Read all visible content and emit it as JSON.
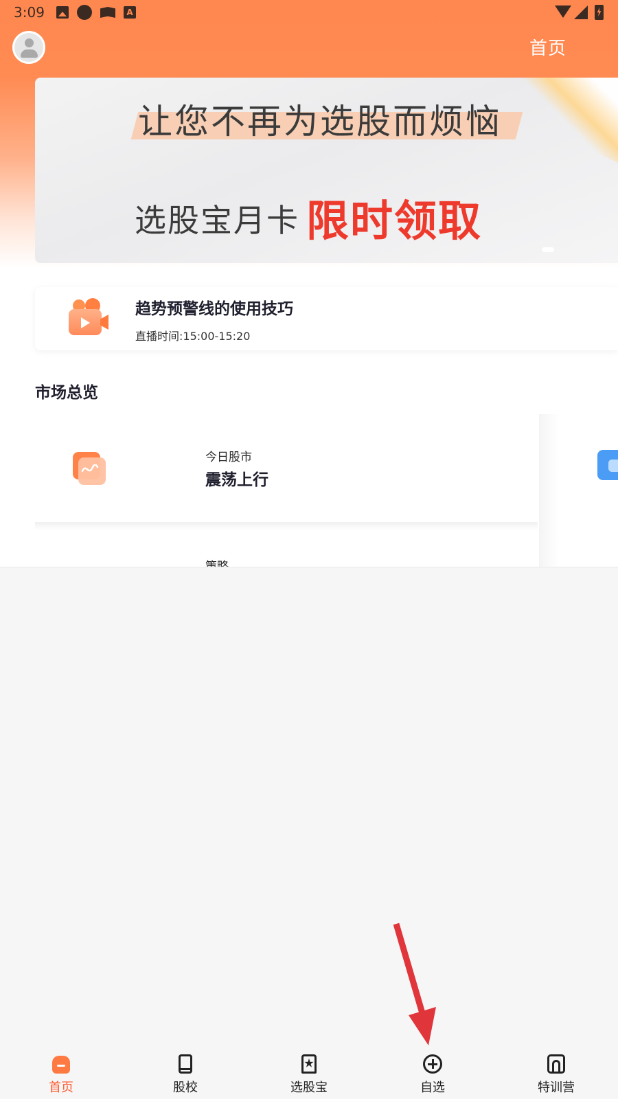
{
  "status_bar": {
    "time": "3:09",
    "icons": [
      "image-icon",
      "circle-icon",
      "map-icon",
      "font-a-icon",
      "wifi-icon",
      "signal-icon",
      "battery-charging-icon"
    ]
  },
  "header": {
    "title": "首页",
    "avatar_icon": "user-avatar-icon"
  },
  "banner": {
    "line1": "让您不再为选股而烦恼",
    "line2_prefix": "选股宝月卡",
    "line2_highlight": "限时领取",
    "highlight_color": "#ee3a2c"
  },
  "live": {
    "title": "趋势预警线的使用技巧",
    "time": "直播时间:15:00-15:20",
    "icon": "video-camera-icon"
  },
  "market": {
    "section_title": "市场总览",
    "cards": [
      {
        "label": "今日股市",
        "value": "震荡上行",
        "icon": "wave-chart-icon"
      }
    ],
    "next_row_label": "策略"
  },
  "tabbar": {
    "active_color": "#ff5a2c",
    "tabs": [
      {
        "label": "首页",
        "icon": "home-icon",
        "active": true
      },
      {
        "label": "股校",
        "icon": "book-icon",
        "active": false
      },
      {
        "label": "选股宝",
        "icon": "bookmark-star-icon",
        "active": false
      },
      {
        "label": "自选",
        "icon": "plus-circle-icon",
        "active": false
      },
      {
        "label": "特训营",
        "icon": "arch-icon",
        "active": false
      }
    ]
  },
  "colors": {
    "brand_orange": "#ff8850",
    "annotation_red": "#e0353a"
  }
}
